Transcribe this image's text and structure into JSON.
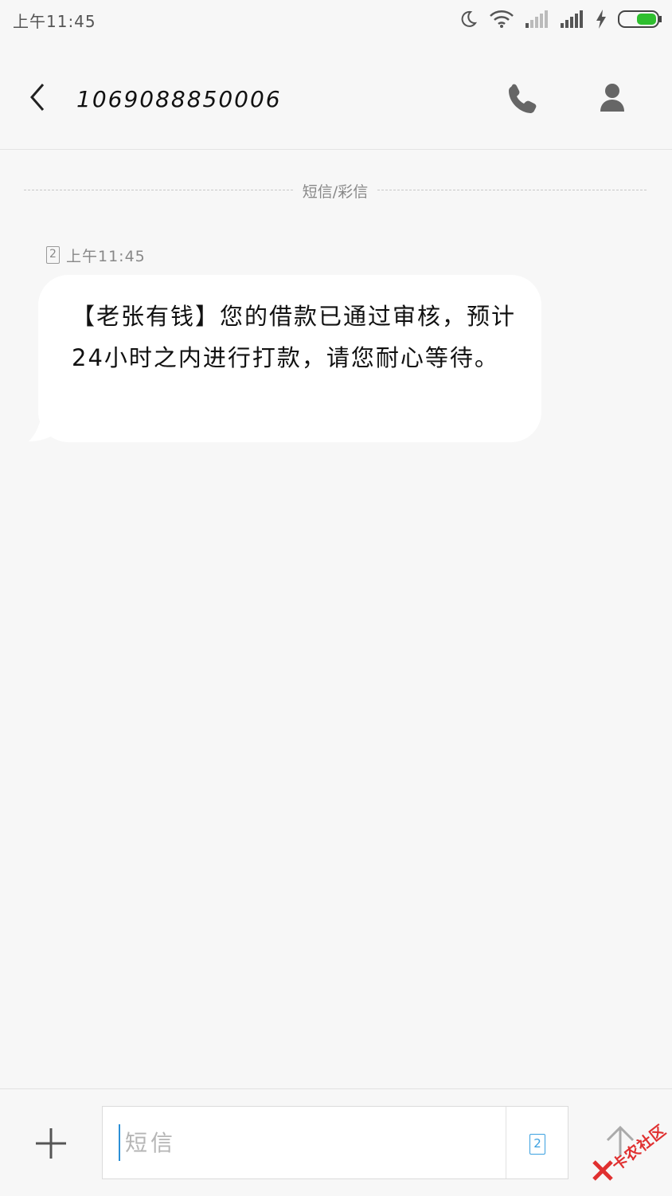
{
  "status_bar": {
    "time": "上午11:45",
    "icons": [
      "moon-icon",
      "wifi-icon",
      "signal-icon",
      "signal-icon",
      "charging-icon",
      "battery-icon"
    ],
    "battery_color": "#2fbf2f"
  },
  "header": {
    "contact_number": "1069088850006",
    "icons": {
      "back": "back-arrow-icon",
      "call": "phone-icon",
      "contact": "person-icon"
    }
  },
  "conversation": {
    "divider_label": "短信/彩信",
    "messages": [
      {
        "sim_slot": "2",
        "time": "上午11:45",
        "text": "【老张有钱】您的借款已通过审核，预计24小时之内进行打款，请您耐心等待。"
      }
    ]
  },
  "composer": {
    "placeholder": "短信",
    "sim_slot": "2",
    "icons": {
      "attach": "plus-icon",
      "send": "send-arrow-icon"
    },
    "accent": "#2b8fd6"
  },
  "watermark": {
    "text": "卡农社区",
    "color": "#e03030"
  }
}
